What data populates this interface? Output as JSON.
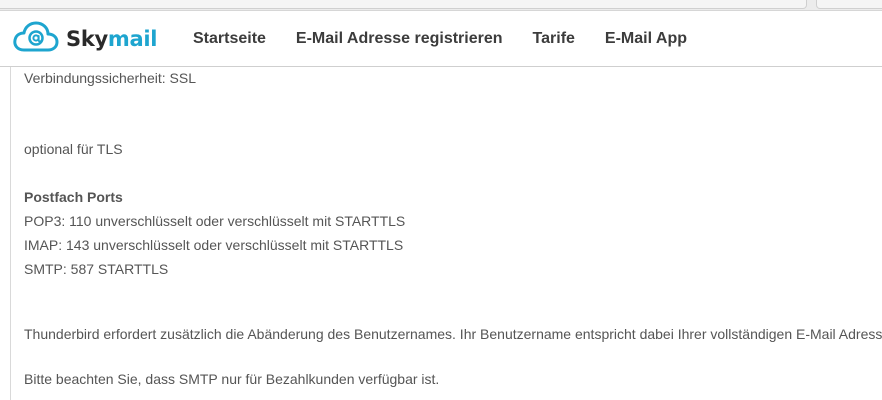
{
  "header": {
    "logo": {
      "icon": "cloud-at-icon",
      "text_part1": "Sky",
      "text_part2": "mail",
      "brand_color": "#1ea5cf"
    },
    "nav": [
      {
        "label": "Startseite"
      },
      {
        "label": "E-Mail Adresse registrieren"
      },
      {
        "label": "Tarife"
      },
      {
        "label": "E-Mail App"
      }
    ]
  },
  "content": {
    "connection_security": "Verbindungssicherheit: SSL",
    "optional_tls": "optional für TLS",
    "ports_heading": "Postfach Ports",
    "ports": [
      "POP3: 110 unverschlüsselt oder verschlüsselt mit STARTTLS",
      "IMAP: 143 unverschlüsselt oder verschlüsselt mit STARTTLS",
      "SMTP: 587 STARTTLS"
    ],
    "thunderbird_note": "Thunderbird erfordert zusätzlich die Abänderung des Benutzernames. Ihr Benutzername entspricht dabei Ihrer vollständigen E-Mail Adresse.",
    "smtp_note": "Bitte beachten Sie, dass SMTP nur für Bezahlkunden verfügbar ist."
  }
}
